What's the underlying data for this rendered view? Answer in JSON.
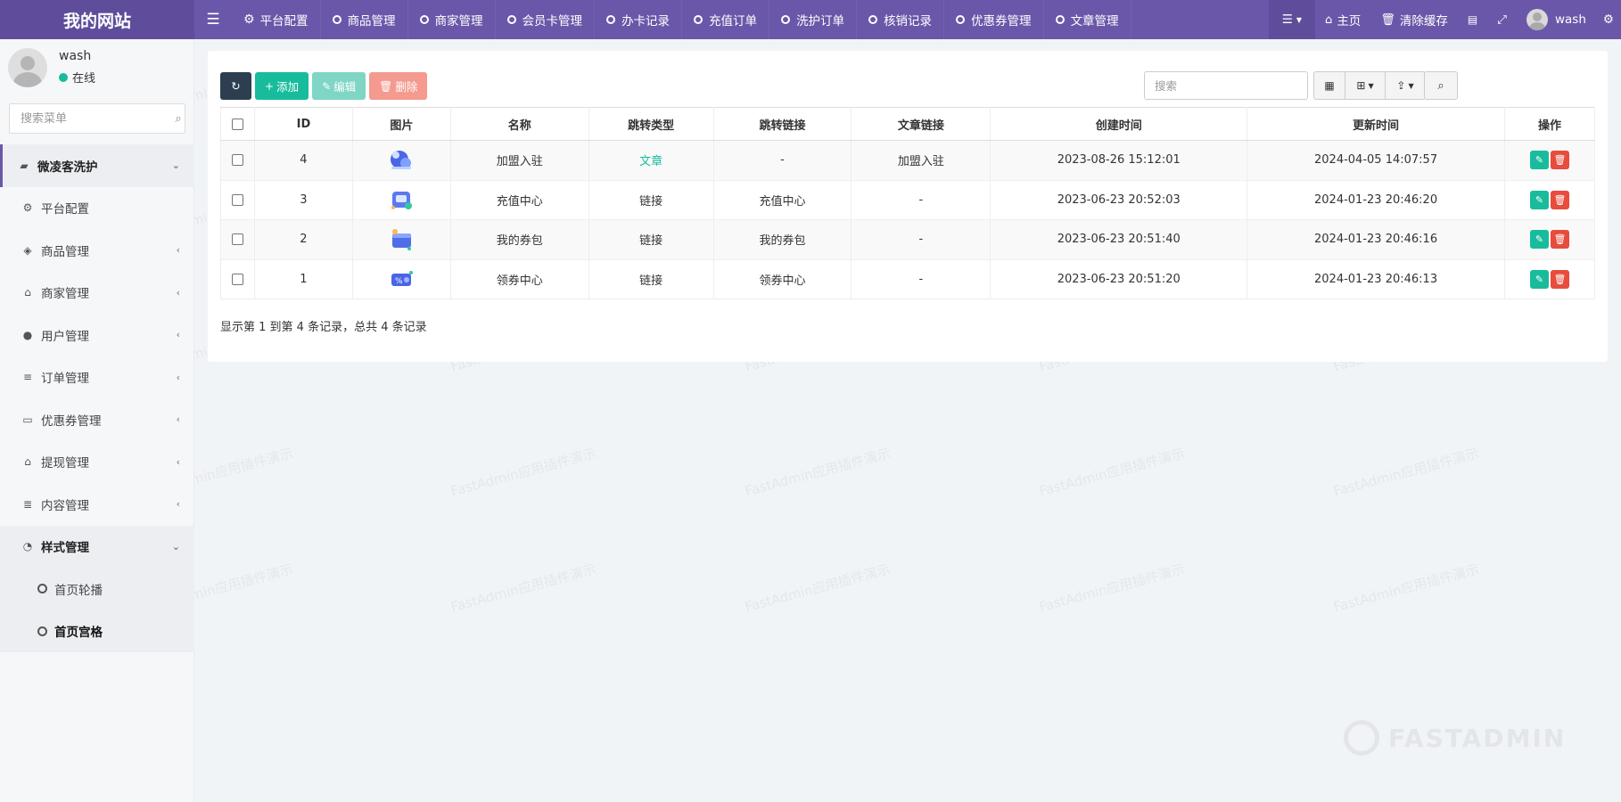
{
  "header": {
    "logo": "我的网站",
    "nav_tabs": [
      {
        "label": "平台配置",
        "icon": "gear-icon"
      },
      {
        "label": "商品管理",
        "icon": "circle-icon"
      },
      {
        "label": "商家管理",
        "icon": "circle-icon"
      },
      {
        "label": "会员卡管理",
        "icon": "circle-icon"
      },
      {
        "label": "办卡记录",
        "icon": "circle-icon"
      },
      {
        "label": "充值订单",
        "icon": "circle-icon"
      },
      {
        "label": "洗护订单",
        "icon": "circle-icon"
      },
      {
        "label": "核销记录",
        "icon": "circle-icon"
      },
      {
        "label": "优惠券管理",
        "icon": "circle-icon"
      },
      {
        "label": "文章管理",
        "icon": "circle-icon"
      }
    ],
    "home_label": "主页",
    "clear_cache_label": "清除缓存",
    "username": "wash"
  },
  "sidebar": {
    "user": {
      "name": "wash",
      "status": "在线"
    },
    "search_placeholder": "搜索菜单",
    "items": [
      {
        "label": "微凌客洗护",
        "icon": "folder-open-icon",
        "type": "top"
      },
      {
        "label": "平台配置",
        "icon": "gear-icon"
      },
      {
        "label": "商品管理",
        "icon": "cube-icon"
      },
      {
        "label": "商家管理",
        "icon": "bank-icon"
      },
      {
        "label": "用户管理",
        "icon": "user-icon"
      },
      {
        "label": "订单管理",
        "icon": "list-icon"
      },
      {
        "label": "优惠券管理",
        "icon": "money-icon"
      },
      {
        "label": "提现管理",
        "icon": "bank-alt-icon"
      },
      {
        "label": "内容管理",
        "icon": "database-icon"
      },
      {
        "label": "样式管理",
        "icon": "dashboard-icon"
      },
      {
        "label": "首页轮播",
        "icon": "circle-icon"
      },
      {
        "label": "首页宫格",
        "icon": "circle-icon"
      }
    ]
  },
  "toolbar": {
    "add_label": "添加",
    "edit_label": "编辑",
    "delete_label": "删除",
    "search_placeholder": "搜索"
  },
  "table": {
    "columns": [
      "ID",
      "图片",
      "名称",
      "跳转类型",
      "跳转链接",
      "文章链接",
      "创建时间",
      "更新时间",
      "操作"
    ],
    "rows": [
      {
        "id": "4",
        "name": "加盟入驻",
        "jump_type": "文章",
        "jump_link": "-",
        "article_link": "加盟入驻",
        "created": "2023-08-26 15:12:01",
        "updated": "2024-04-05 14:07:57"
      },
      {
        "id": "3",
        "name": "充值中心",
        "jump_type": "链接",
        "jump_link": "充值中心",
        "article_link": "-",
        "created": "2023-06-23 20:52:03",
        "updated": "2024-01-23 20:46:20"
      },
      {
        "id": "2",
        "name": "我的券包",
        "jump_type": "链接",
        "jump_link": "我的券包",
        "article_link": "-",
        "created": "2023-06-23 20:51:40",
        "updated": "2024-01-23 20:46:16"
      },
      {
        "id": "1",
        "name": "领券中心",
        "jump_type": "链接",
        "jump_link": "领券中心",
        "article_link": "-",
        "created": "2023-06-23 20:51:20",
        "updated": "2024-01-23 20:46:13"
      }
    ]
  },
  "pagination_info": "显示第 1 到第 4 条记录，总共 4 条记录",
  "watermark_text": "FastAdmin应用插件演示",
  "brand_watermark": "FASTADMIN",
  "colors": {
    "header_bg": "#6a57a9",
    "accent_green": "#18bc9c",
    "danger_red": "#e74c3c",
    "dark_button": "#2c3e50"
  }
}
